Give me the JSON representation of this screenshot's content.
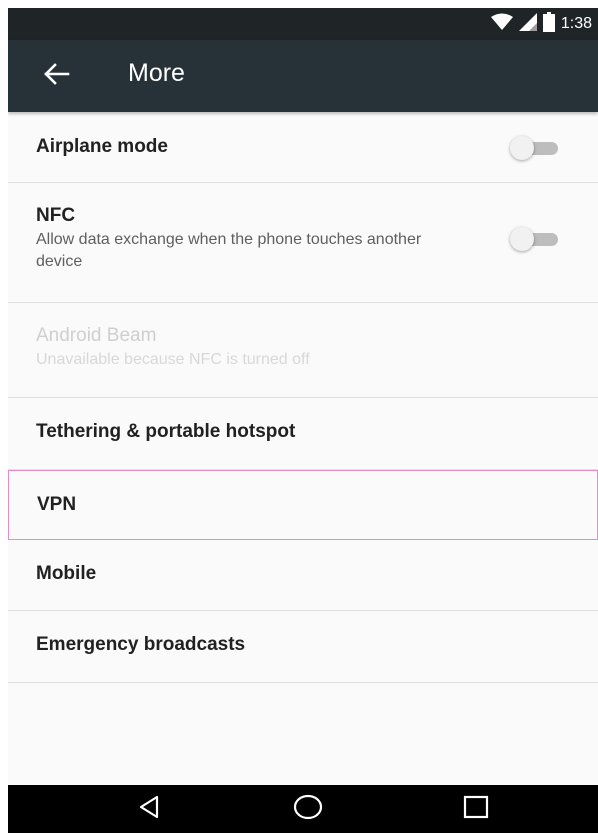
{
  "status_bar": {
    "time": "1:38",
    "icons": [
      "wifi-icon",
      "signal-icon",
      "battery-icon"
    ]
  },
  "toolbar": {
    "back_icon": "arrow-back-icon",
    "title": "More"
  },
  "items": [
    {
      "title": "Airplane mode",
      "toggle": "off"
    },
    {
      "title": "NFC",
      "subtitle": "Allow data exchange when the phone touches another device",
      "toggle": "off"
    },
    {
      "title": "Android Beam",
      "subtitle": "Unavailable because NFC is turned off",
      "disabled": true
    },
    {
      "title": "Tethering & portable hotspot"
    },
    {
      "title": "VPN"
    },
    {
      "title": "Mobile"
    },
    {
      "title": "Emergency broadcasts"
    }
  ],
  "nav_bar": {
    "icons": [
      "nav-back-icon",
      "nav-home-icon",
      "nav-recents-icon"
    ]
  },
  "colors": {
    "toolbar": "#263238",
    "status_bar": "#1f2427",
    "background": "#fafafa",
    "focus_outline": "#e98bc4"
  }
}
